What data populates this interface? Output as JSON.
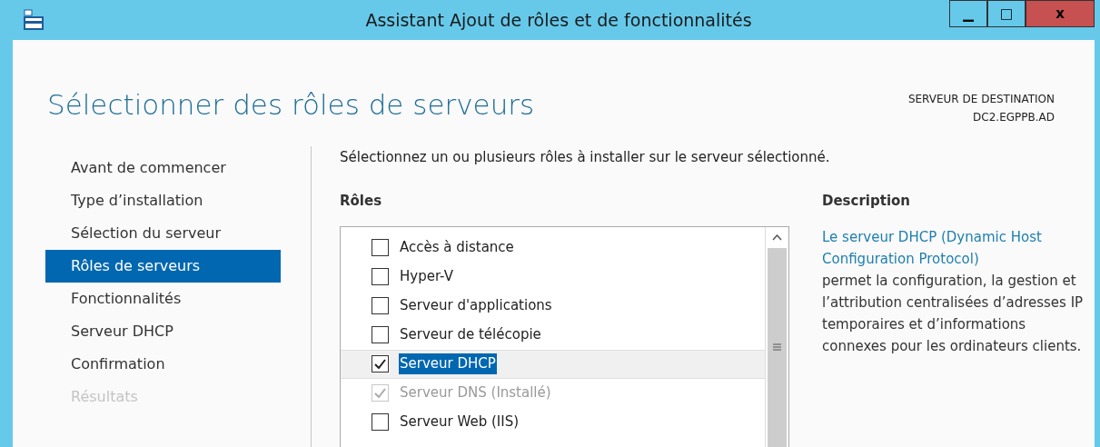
{
  "window": {
    "title": "Assistant Ajout de rôles et de fonctionnalités",
    "controls": [
      "▁",
      "□",
      "x"
    ]
  },
  "page_title": "Sélectionner des rôles de serveurs",
  "destination": {
    "label": "SERVEUR DE DESTINATION",
    "server": "DC2.EGPPB.AD"
  },
  "sidebar": {
    "items": [
      {
        "label": "Avant de commencer",
        "selected": false,
        "disabled": false
      },
      {
        "label": "Type d’installation",
        "selected": false,
        "disabled": false
      },
      {
        "label": "Sélection du serveur",
        "selected": false,
        "disabled": false
      },
      {
        "label": "Rôles de serveurs",
        "selected": true,
        "disabled": false
      },
      {
        "label": "Fonctionnalités",
        "selected": false,
        "disabled": false
      },
      {
        "label": "Serveur DHCP",
        "selected": false,
        "disabled": false
      },
      {
        "label": "Confirmation",
        "selected": false,
        "disabled": false
      },
      {
        "label": "Résultats",
        "selected": false,
        "disabled": true
      }
    ]
  },
  "instruction": "Sélectionnez un ou plusieurs rôles à installer sur le serveur sélectionné.",
  "roles": {
    "heading": "Rôles",
    "items": [
      {
        "label": "Accès à distance",
        "checked": false,
        "disabled": false,
        "selected": false
      },
      {
        "label": "Hyper-V",
        "checked": false,
        "disabled": false,
        "selected": false
      },
      {
        "label": "Serveur d'applications",
        "checked": false,
        "disabled": false,
        "selected": false
      },
      {
        "label": "Serveur de télécopie",
        "checked": false,
        "disabled": false,
        "selected": false
      },
      {
        "label": "Serveur DHCP",
        "checked": true,
        "disabled": false,
        "selected": true
      },
      {
        "label": "Serveur DNS (Installé)",
        "checked": true,
        "disabled": true,
        "selected": false
      },
      {
        "label": "Serveur Web (IIS)",
        "checked": false,
        "disabled": false,
        "selected": false
      }
    ]
  },
  "description": {
    "heading": "Description",
    "link": "Le serveur DHCP (Dynamic Host Configuration Protocol)",
    "text": " permet la configuration, la gestion et l’attribution centralisées d’adresses IP temporaires et d’informations connexes pour les ordinateurs clients."
  }
}
